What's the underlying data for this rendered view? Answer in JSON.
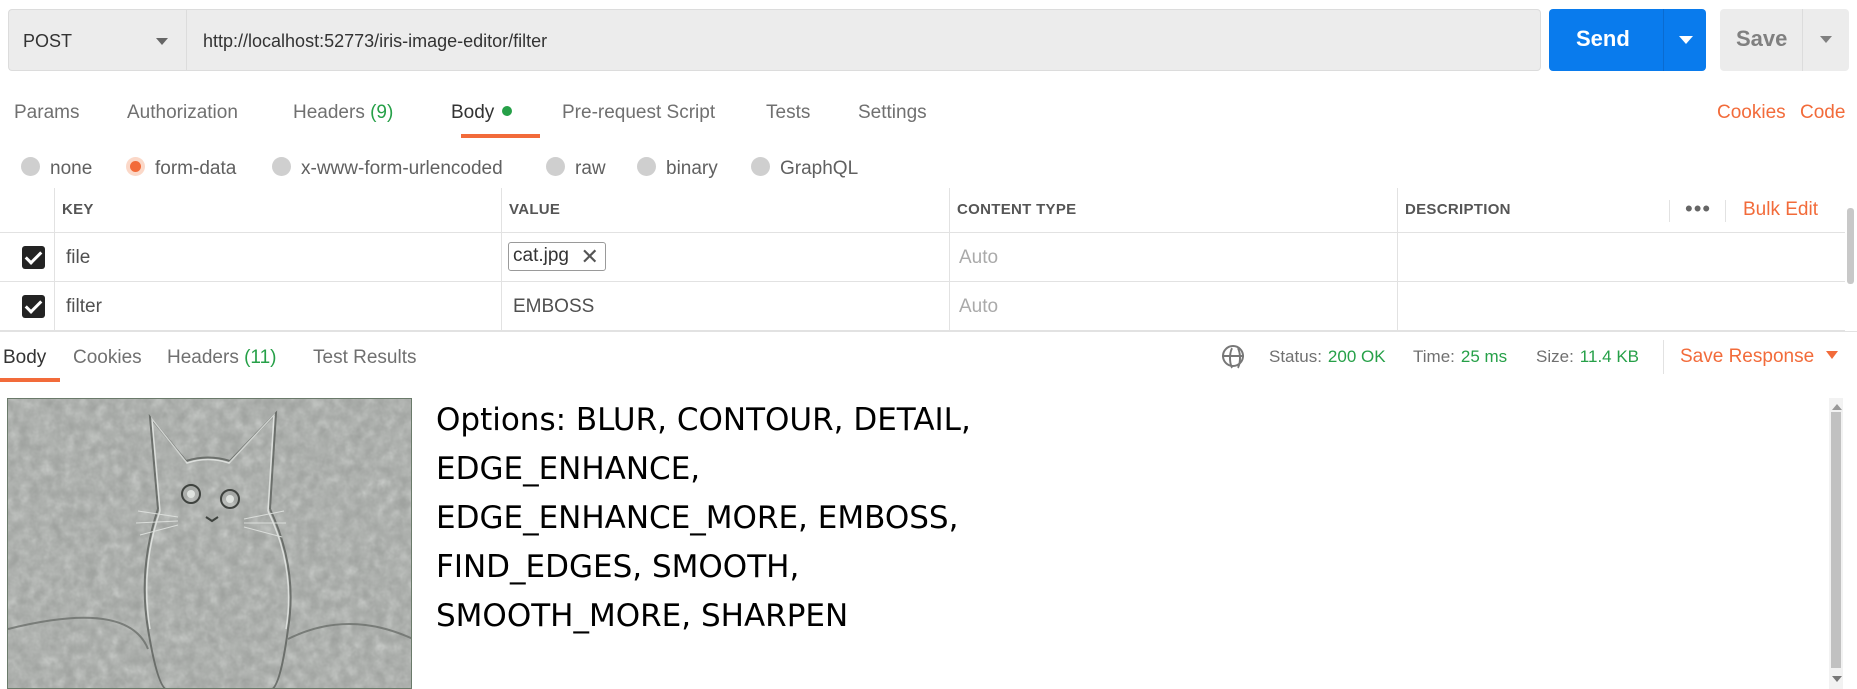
{
  "request": {
    "method": "POST",
    "url": "http://localhost:52773/iris-image-editor/filter",
    "send_label": "Send",
    "save_label": "Save"
  },
  "request_tabs": [
    {
      "label": "Params"
    },
    {
      "label": "Authorization"
    },
    {
      "label": "Headers",
      "count": "(9)"
    },
    {
      "label": "Body",
      "active": true
    },
    {
      "label": "Pre-request Script"
    },
    {
      "label": "Tests"
    },
    {
      "label": "Settings"
    }
  ],
  "top_links": {
    "cookies": "Cookies",
    "code": "Code"
  },
  "body_types": [
    {
      "label": "none"
    },
    {
      "label": "form-data",
      "selected": true
    },
    {
      "label": "x-www-form-urlencoded"
    },
    {
      "label": "raw"
    },
    {
      "label": "binary"
    },
    {
      "label": "GraphQL"
    }
  ],
  "form_table": {
    "headers": [
      "KEY",
      "VALUE",
      "CONTENT TYPE",
      "DESCRIPTION"
    ],
    "bulk_edit": "Bulk Edit",
    "more": "•••",
    "rows": [
      {
        "checked": true,
        "key": "file",
        "value": "cat.jpg",
        "value_type": "file",
        "content_type": "Auto",
        "description": ""
      },
      {
        "checked": true,
        "key": "filter",
        "value": "EMBOSS",
        "value_type": "text",
        "content_type": "Auto",
        "description": ""
      }
    ]
  },
  "response_tabs": [
    {
      "label": "Body",
      "active": true
    },
    {
      "label": "Cookies"
    },
    {
      "label": "Headers",
      "count": "(11)"
    },
    {
      "label": "Test Results"
    }
  ],
  "response_meta": {
    "status_label": "Status:",
    "status": "200 OK",
    "time_label": "Time:",
    "time": "25 ms",
    "size_label": "Size:",
    "size": "11.4 KB",
    "save_response": "Save Response"
  },
  "response_body": {
    "image_alt": "embossed cat image",
    "options_lines": [
      "Options: BLUR, CONTOUR, DETAIL,",
      "EDGE_ENHANCE,",
      "EDGE_ENHANCE_MORE, EMBOSS,",
      "FIND_EDGES, SMOOTH,",
      "SMOOTH_MORE, SHARPEN"
    ]
  },
  "colors": {
    "accent": "#f26b3a",
    "send_blue": "#097bed",
    "status_green": "#26a048"
  }
}
